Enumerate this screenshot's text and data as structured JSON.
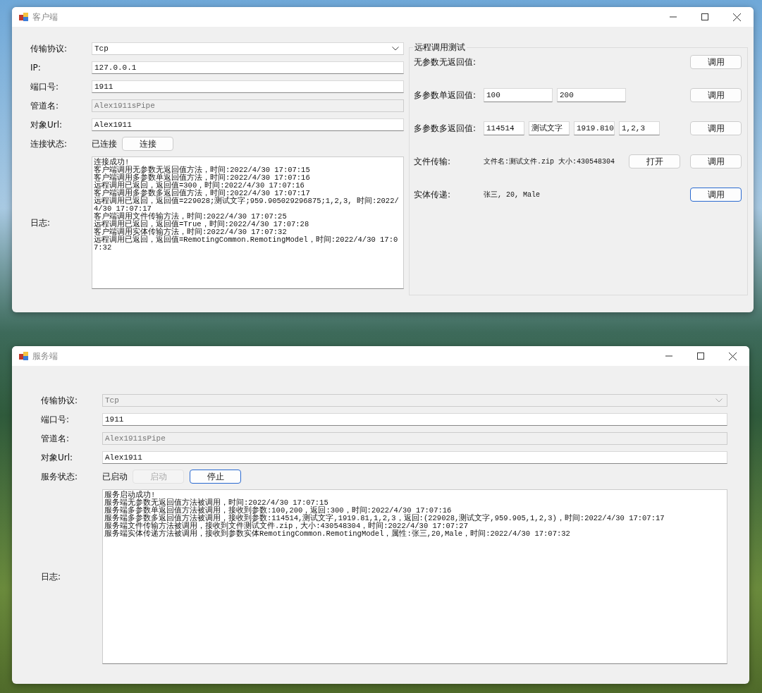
{
  "client_window": {
    "title": "客户端",
    "form": [
      {
        "kind": "combo",
        "label": "传输协议:",
        "value": "Tcp",
        "disabled": false
      },
      {
        "kind": "text",
        "label": "IP:",
        "value": "127.0.0.1",
        "disabled": false
      },
      {
        "kind": "text",
        "label": "端口号:",
        "value": "1911",
        "disabled": false
      },
      {
        "kind": "text",
        "label": "管道名:",
        "value": "Alex1911sPipe",
        "disabled": true
      },
      {
        "kind": "text",
        "label": "对象Url:",
        "value": "Alex1911",
        "disabled": false
      }
    ],
    "status": {
      "label": "连接状态:",
      "text": "已连接",
      "buttons": [
        {
          "label": "连接",
          "disabled": false,
          "focused": false
        }
      ]
    },
    "log": {
      "label": "日志:",
      "lines": [
        "连接成功!",
        "客户端调用无参数无返回值方法，时间:2022/4/30 17:07:15",
        "客户端调用多参数单返回值方法，时间:2022/4/30 17:07:16",
        "远程调用已返回，返回值=300，时间:2022/4/30 17:07:16",
        "客户端调用多参数多返回值方法，时间:2022/4/30 17:07:17",
        "远程调用已返回，返回值=229028;测试文字;959.905029296875;1,2,3, 时间:2022/4/30 17:07:17",
        "客户端调用文件传输方法，时间:2022/4/30 17:07:25",
        "远程调用已返回，返回值=True，时间:2022/4/30 17:07:28",
        "客户端调用实体传输方法，时间:2022/4/30 17:07:32",
        "远程调用已返回，返回值=RemotingCommon.RemotingModel，时间:2022/4/30 17:07:32"
      ]
    },
    "remote_test": {
      "title": "远程调用测试",
      "rows": [
        {
          "label": "无参数无返回值:",
          "fields": [],
          "texts": [],
          "buttons": [
            {
              "label": "调用",
              "focused": false
            }
          ]
        },
        {
          "label": "多参数单返回值:",
          "fields": [
            "100",
            "200"
          ],
          "texts": [],
          "buttons": [
            {
              "label": "调用",
              "focused": false
            }
          ]
        },
        {
          "label": "多参数多返回值:",
          "fields": [
            "114514",
            "测试文字",
            "1919.810",
            "1,2,3"
          ],
          "texts": [],
          "buttons": [
            {
              "label": "调用",
              "focused": false
            }
          ]
        },
        {
          "label": "文件传输:",
          "fields": [],
          "texts": [
            "文件名:测试文件.zip",
            "大小:430548304"
          ],
          "buttons": [
            {
              "label": "打开",
              "focused": false
            },
            {
              "label": "调用",
              "focused": false
            }
          ]
        },
        {
          "label": "实体传递:",
          "fields": [],
          "texts": [
            "张三, 20, Male"
          ],
          "buttons": [
            {
              "label": "调用",
              "focused": true
            }
          ]
        }
      ]
    }
  },
  "server_window": {
    "title": "服务端",
    "form": [
      {
        "kind": "combo",
        "label": "传输协议:",
        "value": "Tcp",
        "disabled": true
      },
      {
        "kind": "text",
        "label": "端口号:",
        "value": "1911",
        "disabled": false
      },
      {
        "kind": "text",
        "label": "管道名:",
        "value": "Alex1911sPipe",
        "disabled": true
      },
      {
        "kind": "text",
        "label": "对象Url:",
        "value": "Alex1911",
        "disabled": false
      }
    ],
    "status": {
      "label": "服务状态:",
      "text": "已启动",
      "buttons": [
        {
          "label": "启动",
          "disabled": true,
          "focused": false
        },
        {
          "label": "停止",
          "disabled": false,
          "focused": true
        }
      ]
    },
    "log": {
      "label": "日志:",
      "lines": [
        "服务启动成功!",
        "服务端无参数无返回值方法被调用，时间:2022/4/30 17:07:15",
        "服务端多参数单返回值方法被调用，接收到参数:100,200，返回:300，时间:2022/4/30 17:07:16",
        "服务端多参数多返回值方法被调用，接收到参数:114514,测试文字,1919.81,1,2,3，返回:(229028,测试文字,959.905,1,2,3)，时间:2022/4/30 17:07:17",
        "服务端文件传输方法被调用，接收到文件测试文件.zip，大小:430548304，时间:2022/4/30 17:07:27",
        "服务端实体传递方法被调用，接收到参数实体RemotingCommon.RemotingModel，属性:张三,20,Male，时间:2022/4/30 17:07:32"
      ]
    }
  }
}
